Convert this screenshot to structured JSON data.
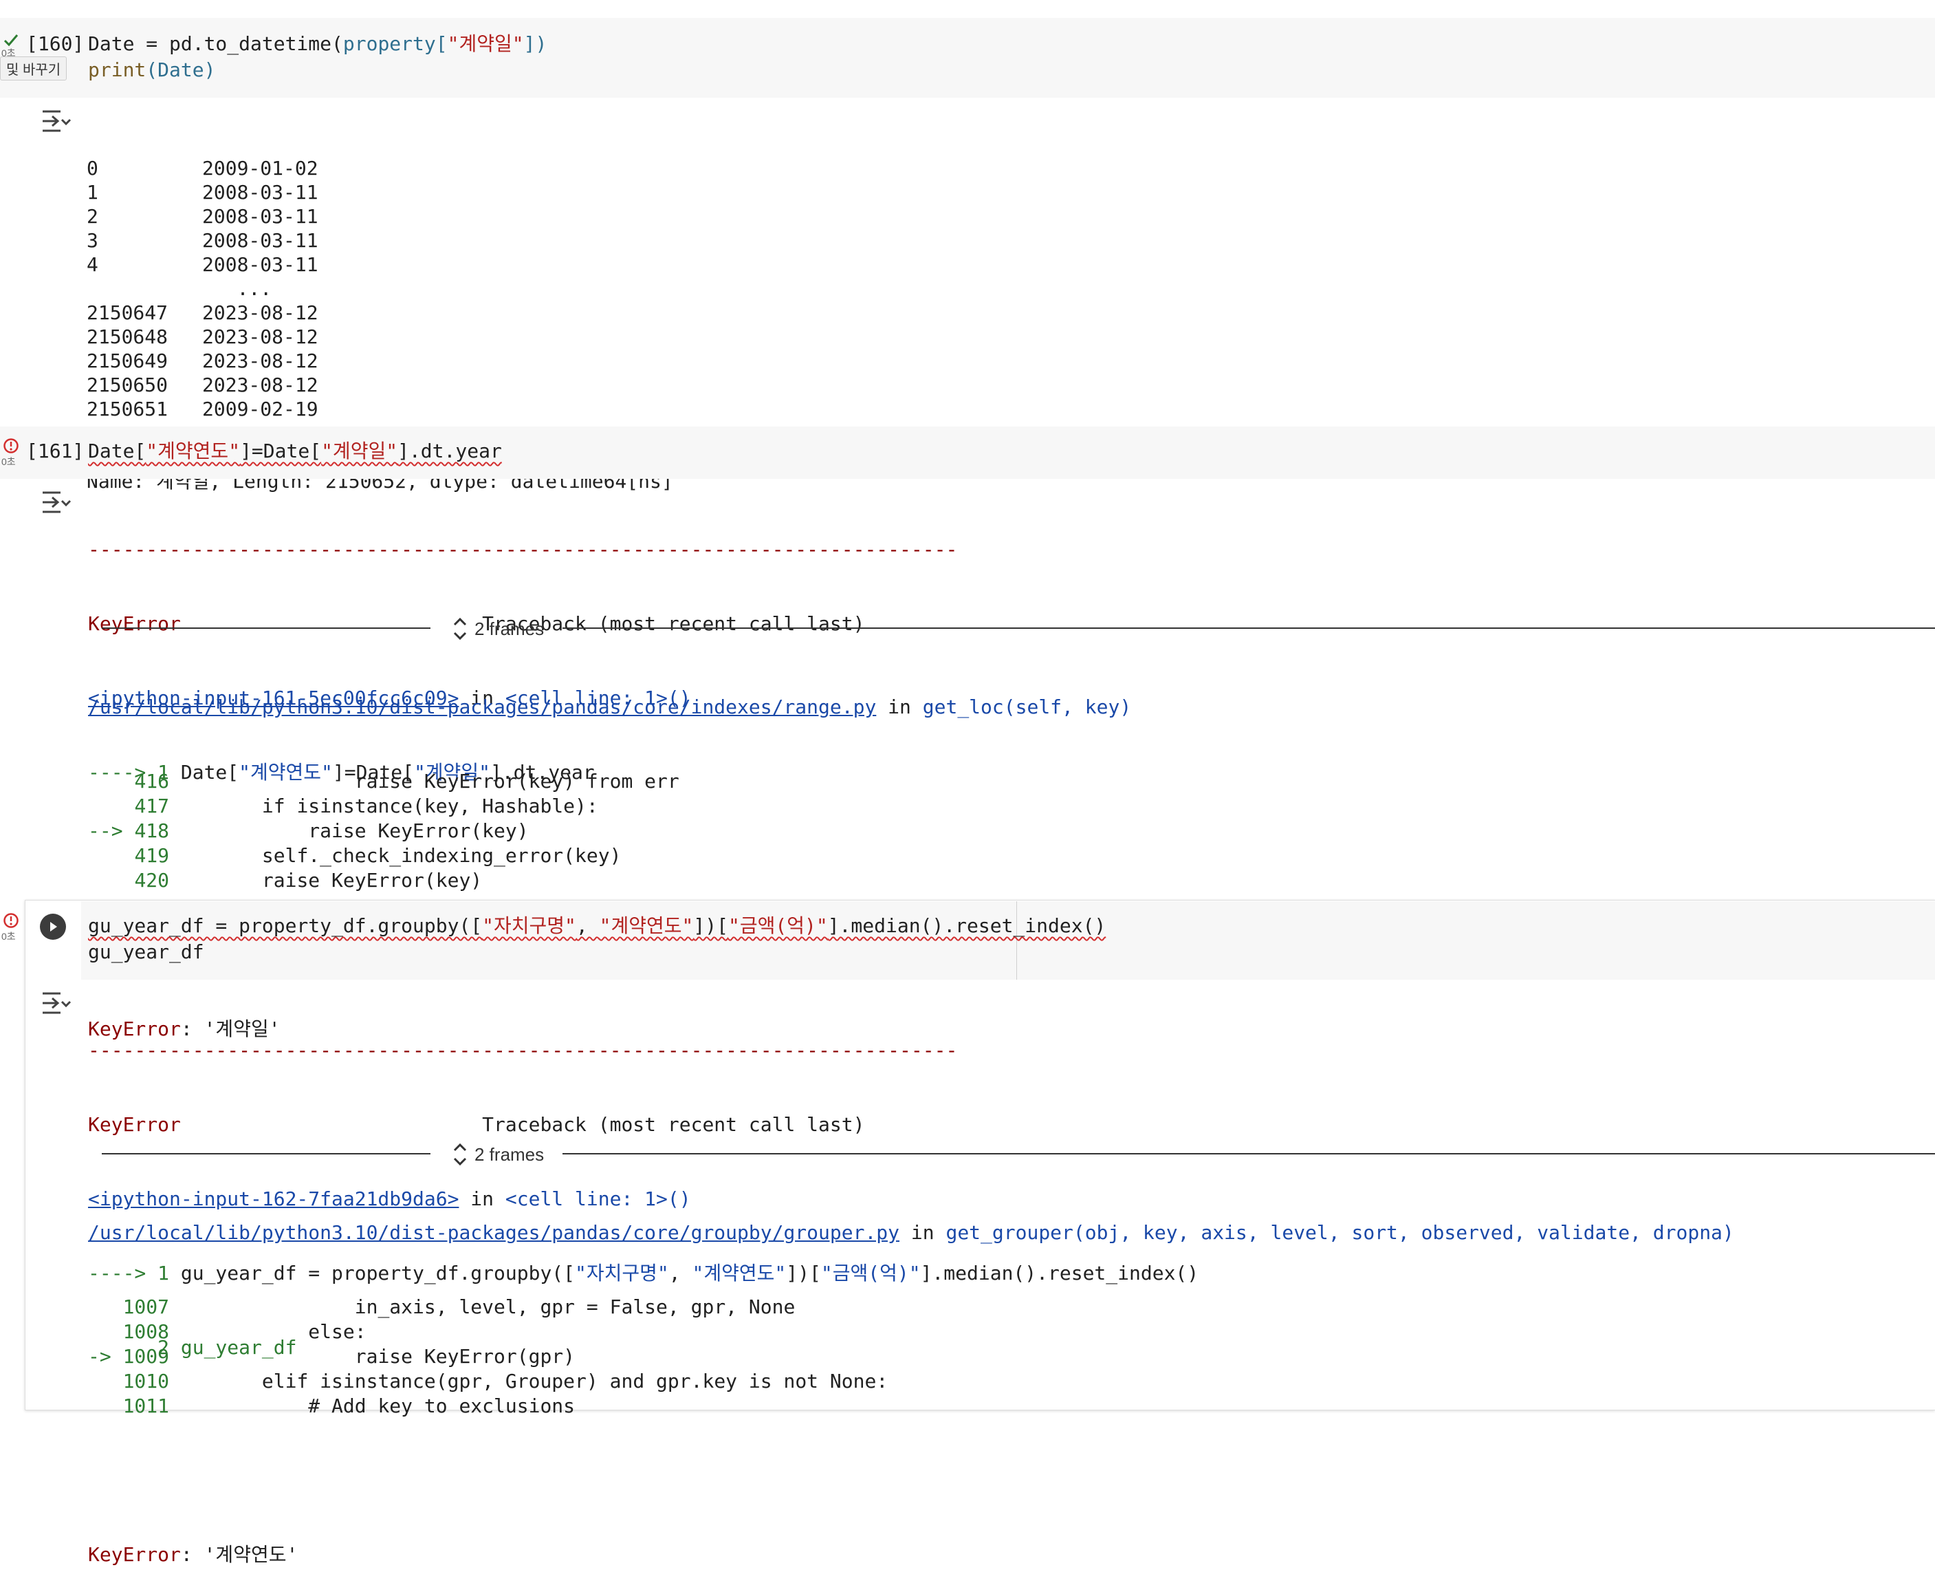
{
  "cell160": {
    "exec_label": "[160]",
    "status_time": "0초",
    "tooltip": "및 바꾸기",
    "code_line1": [
      "Date = pd.to_datetime(",
      "property",
      "[",
      "\"계약일\"",
      "])"
    ],
    "code_line2": [
      "print",
      "(Date)"
    ],
    "output_rows": [
      [
        "0",
        "2009-01-02"
      ],
      [
        "1",
        "2008-03-11"
      ],
      [
        "2",
        "2008-03-11"
      ],
      [
        "3",
        "2008-03-11"
      ],
      [
        "4",
        "2008-03-11"
      ],
      [
        "",
        "   ..."
      ],
      [
        "2150647",
        "2023-08-12"
      ],
      [
        "2150648",
        "2023-08-12"
      ],
      [
        "2150649",
        "2023-08-12"
      ],
      [
        "2150650",
        "2023-08-12"
      ],
      [
        "2150651",
        "2009-02-19"
      ]
    ],
    "output_footer": "Name: 계약일, Length: 2150652, dtype: datetime64[ns]"
  },
  "cell161": {
    "exec_label": "[161]",
    "status_time": "0초",
    "code": [
      "Date[",
      "\"계약연도\"",
      "]=Date[",
      "\"계약일\"",
      "].dt.year"
    ],
    "tb_dashes": "---------------------------------------------------------------------------",
    "tb_error": "KeyError",
    "tb_header": "Traceback (most recent call last)",
    "tb_input_link": "<ipython-input-161-5ec00fcc6c09>",
    "tb_in": " in ",
    "tb_cell_line": "<cell line: 1>()",
    "tb_arrow_line": [
      "----> 1 ",
      "Date[",
      "\"계약연도\"",
      "]=Date[",
      "\"계약일\"",
      "].dt.year"
    ],
    "frames_label": "2 frames",
    "tb_file_link": "/usr/local/lib/python3.10/dist-packages/pandas/core/indexes/range.py",
    "tb_func": "get_loc(self, key)",
    "tb_lines": [
      {
        "prefix": "    ",
        "num": "416",
        "code": "                raise KeyError(key) from err"
      },
      {
        "prefix": "    ",
        "num": "417",
        "code": "        if isinstance(key, Hashable):"
      },
      {
        "prefix": "--> ",
        "num": "418",
        "code": "            raise KeyError(key)"
      },
      {
        "prefix": "    ",
        "num": "419",
        "code": "        self._check_indexing_error(key)"
      },
      {
        "prefix": "    ",
        "num": "420",
        "code": "        raise KeyError(key)"
      }
    ],
    "tb_final_error": "KeyError",
    "tb_final_msg": ": '계약일'"
  },
  "cell162": {
    "status_time": "0초",
    "code_line1": [
      "gu_year_df = property_df.groupby([",
      "\"자치구명\"",
      ", ",
      "\"계약연도\"",
      "])[",
      "\"금액(억)\"",
      "].median().reset_index()"
    ],
    "code_line2": "gu_year_df",
    "tb_dashes": "---------------------------------------------------------------------------",
    "tb_error": "KeyError",
    "tb_header": "Traceback (most recent call last)",
    "tb_input_link": "<ipython-input-162-7faa21db9da6>",
    "tb_in": " in ",
    "tb_cell_line": "<cell line: 1>()",
    "tb_arrow_line": [
      "----> 1 ",
      "gu_year_df = property_df.groupby([",
      "\"자치구명\"",
      ", ",
      "\"계약연도\"",
      "])[",
      "\"금액(억)\"",
      "].median().reset_index()"
    ],
    "tb_line2": "      2 gu_year_df",
    "frames_label": "2 frames",
    "tb_file_link": "/usr/local/lib/python3.10/dist-packages/pandas/core/groupby/grouper.py",
    "tb_func": "get_grouper(obj, key, axis, level, sort, observed, validate, dropna)",
    "tb_lines": [
      {
        "prefix": "   ",
        "num": "1007",
        "code": "                in_axis, level, gpr = False, gpr, None"
      },
      {
        "prefix": "   ",
        "num": "1008",
        "code": "            else:"
      },
      {
        "prefix": "-> ",
        "num": "1009",
        "code": "                raise KeyError(gpr)"
      },
      {
        "prefix": "   ",
        "num": "1010",
        "code": "        elif isinstance(gpr, Grouper) and gpr.key is not None:"
      },
      {
        "prefix": "   ",
        "num": "1011",
        "code": "            # Add key to exclusions"
      }
    ],
    "tb_final_error": "KeyError",
    "tb_final_msg": ": '계약연도'"
  },
  "colors": {
    "success": "#2e7d32",
    "error": "#d32f2f",
    "code_bg": "#f7f7f7",
    "link": "#1a49a8",
    "error_text": "#8b0000"
  }
}
